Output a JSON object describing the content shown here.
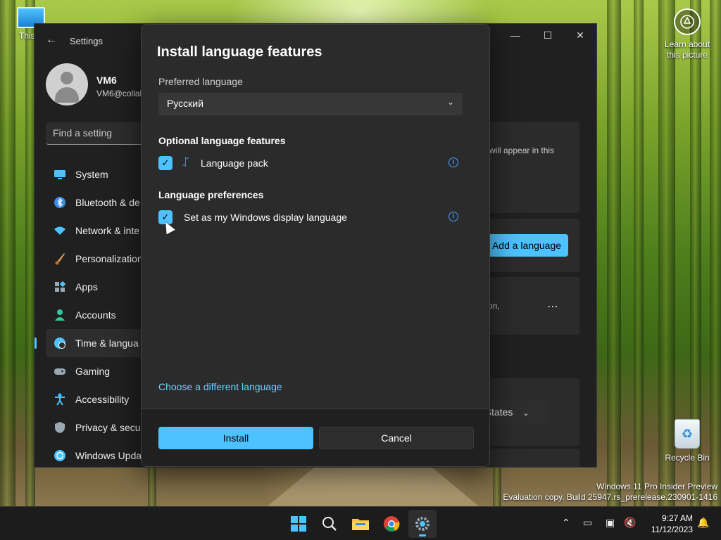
{
  "desktop": {
    "this_pc_label": "This P",
    "recycle_bin_label": "Recycle Bin",
    "learn_line1": "Learn about",
    "learn_line2": "this picture",
    "watermark_line1": "Windows 11 Pro Insider Preview",
    "watermark_line2": "Evaluation copy. Build 25947.rs_prerelease.230901-1416"
  },
  "settings": {
    "title": "Settings",
    "user_name": "VM6",
    "user_email": "VM6@collal",
    "search_placeholder": "Find a setting",
    "nav": [
      {
        "label": "System",
        "icon": "monitor-icon",
        "color": "#4cc2ff"
      },
      {
        "label": "Bluetooth & de",
        "icon": "bluetooth-icon",
        "color": "#3b8ee6"
      },
      {
        "label": "Network & inte",
        "icon": "wifi-icon",
        "color": "#4cc2ff"
      },
      {
        "label": "Personalization",
        "icon": "brush-icon",
        "color": "#e8a060"
      },
      {
        "label": "Apps",
        "icon": "apps-icon",
        "color": "#9aa7b5"
      },
      {
        "label": "Accounts",
        "icon": "person-icon",
        "color": "#33c9a0"
      },
      {
        "label": "Time & langua",
        "icon": "globe-clock-icon",
        "color": "#4cc2ff"
      },
      {
        "label": "Gaming",
        "icon": "gamepad-icon",
        "color": "#9aa7b5"
      },
      {
        "label": "Accessibility",
        "icon": "accessibility-icon",
        "color": "#4cc2ff"
      },
      {
        "label": "Privacy & secu",
        "icon": "shield-icon",
        "color": "#9aa7b5"
      },
      {
        "label": "Windows Upda",
        "icon": "update-icon",
        "color": "#4cc2ff"
      }
    ],
    "active_nav_index": 6,
    "card1_text": "will appear in this",
    "add_language_label": "Add a language",
    "card3_text": "on,",
    "region_value": "d States"
  },
  "dialog": {
    "title": "Install language features",
    "preferred_label": "Preferred language",
    "preferred_value": "Русский",
    "optional_heading": "Optional language features",
    "language_pack_label": "Language pack",
    "language_pack_checked": true,
    "preferences_heading": "Language preferences",
    "display_language_label": "Set as my Windows display language",
    "display_language_checked": true,
    "choose_link": "Choose a different language",
    "install_label": "Install",
    "cancel_label": "Cancel"
  },
  "taskbar": {
    "time": "9:27 AM",
    "date": "11/12/2023",
    "accent": "#4cc2ff"
  }
}
